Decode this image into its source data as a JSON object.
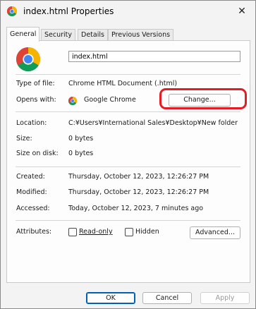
{
  "window": {
    "title": "index.html Properties",
    "close_glyph": "✕"
  },
  "tabs": [
    "General",
    "Security",
    "Details",
    "Previous Versions"
  ],
  "file": {
    "name": "index.html"
  },
  "fields": {
    "type_label": "Type of file:",
    "type_value": "Chrome HTML Document (.html)",
    "opens_label": "Opens with:",
    "opens_value": "Google Chrome",
    "location_label": "Location:",
    "location_value": "C:¥Users¥International Sales¥Desktop¥New folder",
    "size_label": "Size:",
    "size_value": "0 bytes",
    "size_disk_label": "Size on disk:",
    "size_disk_value": "0 bytes",
    "created_label": "Created:",
    "created_value": "Thursday, October 12, 2023, 12:26:27 PM",
    "modified_label": "Modified:",
    "modified_value": "Thursday, October 12, 2023, 12:26:27 PM",
    "accessed_label": "Accessed:",
    "accessed_value": "Today, October 12, 2023, 7 minutes ago",
    "attributes_label": "Attributes:"
  },
  "buttons": {
    "change": "Change...",
    "advanced": "Advanced...",
    "ok": "OK",
    "cancel": "Cancel",
    "apply": "Apply"
  },
  "attributes": {
    "readonly": "Read-only",
    "hidden": "Hidden",
    "readonly_checked": false,
    "hidden_checked": false
  },
  "icons": {
    "app": "chrome-icon",
    "file": "chrome-icon",
    "close": "close-icon"
  },
  "colors": {
    "highlight": "#e41d24",
    "accent": "#005fb8"
  }
}
